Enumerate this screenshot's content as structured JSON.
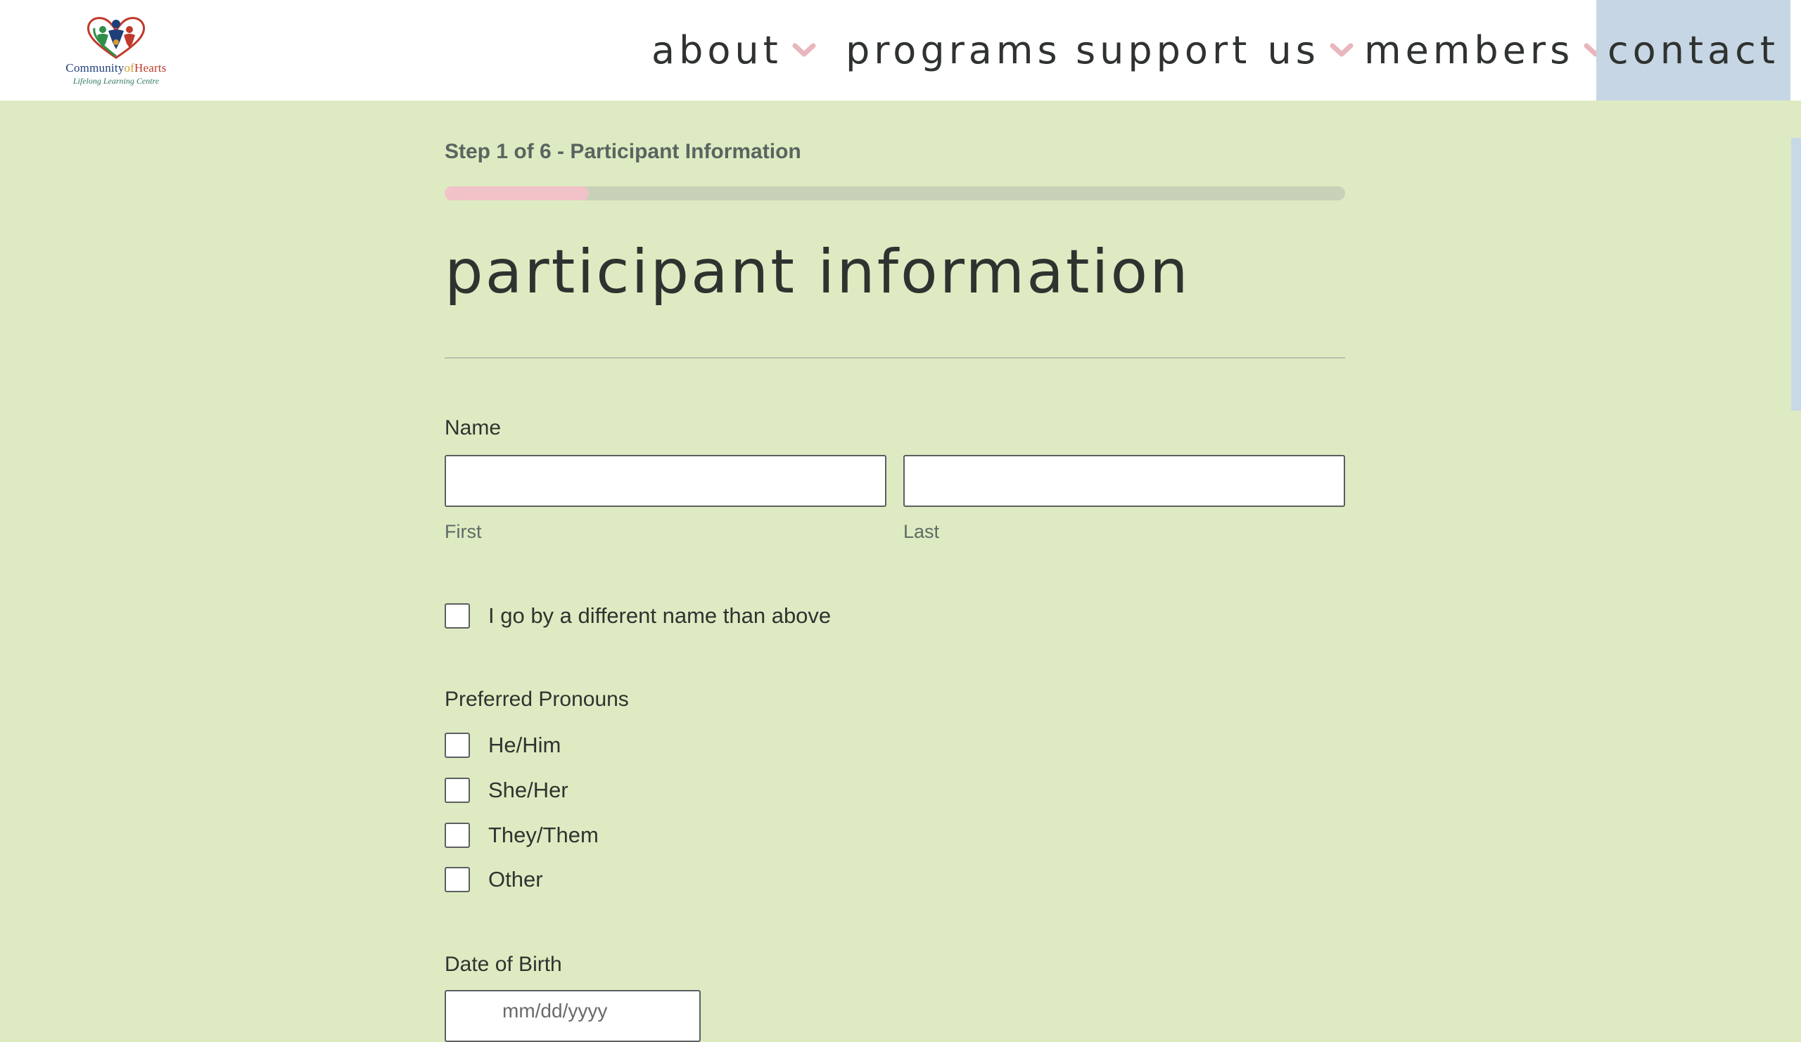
{
  "header": {
    "logo": {
      "title_part1": "Community",
      "title_part2": "of",
      "title_part3": "Hearts",
      "subtitle": "Lifelong Learning Centre"
    },
    "nav": [
      {
        "label": "about",
        "has_dropdown": true
      },
      {
        "label": "programs",
        "has_dropdown": false
      },
      {
        "label": "support us",
        "has_dropdown": true
      },
      {
        "label": "members",
        "has_dropdown": true
      },
      {
        "label": "contact",
        "has_dropdown": false,
        "highlighted": true
      }
    ],
    "accent_color": "#e8b7bd",
    "contact_bg": "#c6d6e4"
  },
  "form": {
    "step_label": "Step 1 of 6 - Participant Information",
    "progress": {
      "current_step": 1,
      "total_steps": 6,
      "fraction": 0.16
    },
    "title": "participant information",
    "name": {
      "label": "Name",
      "first": {
        "value": "",
        "sublabel": "First"
      },
      "last": {
        "value": "",
        "sublabel": "Last"
      }
    },
    "different_name": {
      "label": "I go by a different name than above",
      "checked": false
    },
    "pronouns": {
      "label": "Preferred Pronouns",
      "options": [
        {
          "label": "He/Him",
          "checked": false
        },
        {
          "label": "She/Her",
          "checked": false
        },
        {
          "label": "They/Them",
          "checked": false
        },
        {
          "label": "Other",
          "checked": false
        }
      ]
    },
    "dob": {
      "label": "Date of Birth",
      "placeholder": "mm/dd/yyyy"
    }
  },
  "colors": {
    "page_bg": "#deebc2",
    "progress_fill": "#f2c2c9",
    "progress_track": "#c7d2b8"
  }
}
